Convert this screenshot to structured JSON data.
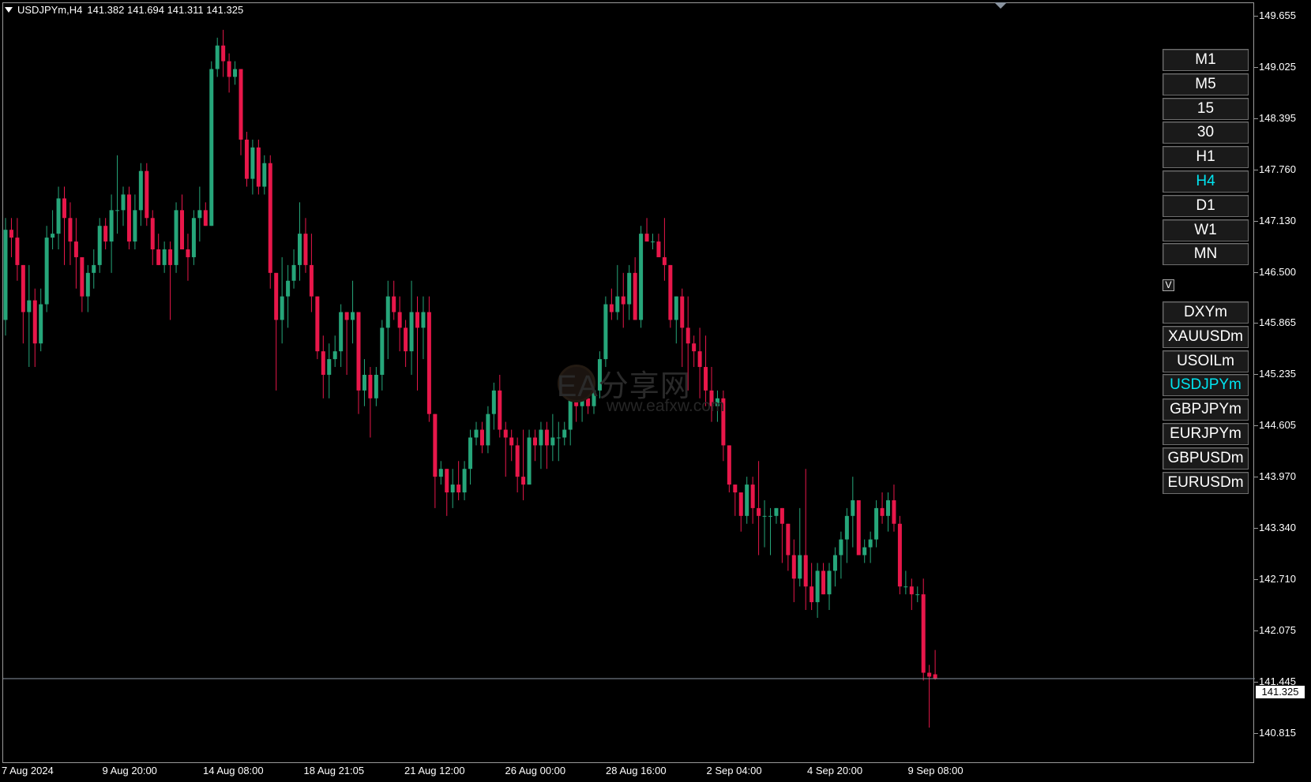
{
  "header": {
    "symbol_timeframe": "USDJPYm,H4",
    "ohlc": "141.382 141.694 141.311 141.325"
  },
  "timeframe_buttons": [
    "M1",
    "M5",
    "15",
    "30",
    "H1",
    "H4",
    "D1",
    "W1",
    "MN"
  ],
  "active_timeframe": "H4",
  "toggle_label": "V",
  "symbol_buttons": [
    "DXYm",
    "XAUUSDm",
    "USOILm",
    "USDJPYm",
    "GBPJPYm",
    "EURJPYm",
    "GBPUSDm",
    "EURUSDm"
  ],
  "active_symbol": "USDJPYm",
  "price_axis": [
    "149.655",
    "149.025",
    "148.395",
    "147.760",
    "147.130",
    "146.500",
    "145.865",
    "145.235",
    "144.605",
    "143.970",
    "143.340",
    "142.710",
    "142.075",
    "141.445",
    "140.815"
  ],
  "time_axis": [
    "7 Aug 2024",
    "9 Aug 20:00",
    "14 Aug 08:00",
    "18 Aug 21:05",
    "21 Aug 12:00",
    "26 Aug 00:00",
    "28 Aug 16:00",
    "2 Sep 04:00",
    "4 Sep 20:00",
    "9 Sep 08:00"
  ],
  "bid_price": "141.325",
  "watermark": {
    "title": "EA分享网",
    "url": "www.eafxw.com"
  },
  "colors": {
    "bull": "#26a67a",
    "bear": "#e8174a",
    "active_text": "#00e4f0",
    "bid_line": "#8a94a0"
  },
  "chart_data": {
    "type": "candlestick",
    "ylim": [
      140.6,
      149.85
    ],
    "bid": 141.325,
    "candles": [
      [
        145.9,
        147.2,
        145.7,
        147.05
      ],
      [
        147.05,
        147.2,
        146.7,
        146.95
      ],
      [
        146.95,
        147.2,
        146.4,
        146.6
      ],
      [
        146.6,
        146.6,
        145.6,
        146.0
      ],
      [
        146.0,
        146.6,
        145.3,
        146.15
      ],
      [
        146.15,
        146.3,
        145.3,
        145.6
      ],
      [
        145.6,
        146.3,
        145.5,
        146.1
      ],
      [
        146.1,
        147.1,
        146.0,
        146.95
      ],
      [
        146.95,
        147.3,
        146.8,
        147.0
      ],
      [
        147.0,
        147.6,
        146.8,
        147.45
      ],
      [
        147.45,
        147.6,
        146.6,
        147.2
      ],
      [
        147.2,
        147.4,
        146.6,
        146.9
      ],
      [
        146.9,
        147.2,
        146.3,
        146.7
      ],
      [
        146.7,
        146.7,
        146.0,
        146.2
      ],
      [
        146.2,
        146.6,
        146.0,
        146.5
      ],
      [
        146.5,
        146.8,
        146.3,
        146.6
      ],
      [
        146.6,
        147.2,
        146.5,
        147.1
      ],
      [
        147.1,
        147.2,
        146.8,
        146.9
      ],
      [
        146.9,
        147.5,
        146.5,
        147.3
      ],
      [
        147.3,
        148.0,
        147.0,
        147.3
      ],
      [
        147.3,
        147.6,
        147.1,
        147.5
      ],
      [
        147.5,
        147.6,
        146.8,
        146.9
      ],
      [
        146.9,
        147.5,
        146.8,
        147.3
      ],
      [
        147.3,
        147.9,
        147.1,
        147.8
      ],
      [
        147.8,
        147.9,
        147.1,
        147.2
      ],
      [
        147.2,
        147.3,
        146.6,
        146.8
      ],
      [
        146.8,
        147.0,
        146.6,
        146.6
      ],
      [
        146.6,
        146.9,
        146.5,
        146.8
      ],
      [
        146.8,
        146.9,
        145.9,
        146.6
      ],
      [
        146.6,
        147.4,
        146.5,
        147.3
      ],
      [
        147.3,
        147.5,
        146.8,
        146.8
      ],
      [
        146.8,
        147.0,
        146.4,
        146.7
      ],
      [
        146.7,
        147.3,
        146.6,
        147.2
      ],
      [
        147.2,
        147.6,
        146.9,
        147.3
      ],
      [
        147.3,
        147.4,
        147.1,
        147.1
      ],
      [
        147.1,
        149.2,
        147.1,
        149.1
      ],
      [
        149.1,
        149.5,
        149.0,
        149.4
      ],
      [
        149.4,
        149.6,
        149.0,
        149.2
      ],
      [
        149.2,
        149.3,
        148.8,
        149.0
      ],
      [
        149.0,
        149.2,
        148.9,
        149.1
      ],
      [
        149.1,
        149.1,
        148.0,
        148.2
      ],
      [
        148.2,
        148.3,
        147.6,
        147.7
      ],
      [
        147.7,
        148.2,
        147.5,
        148.1
      ],
      [
        148.1,
        148.2,
        147.5,
        147.6
      ],
      [
        147.6,
        148.0,
        147.5,
        147.9
      ],
      [
        147.9,
        148.0,
        146.3,
        146.5
      ],
      [
        146.5,
        146.5,
        145.0,
        145.9
      ],
      [
        145.9,
        146.7,
        145.6,
        146.2
      ],
      [
        146.2,
        146.6,
        145.8,
        146.4
      ],
      [
        146.4,
        146.8,
        146.3,
        146.6
      ],
      [
        146.6,
        147.4,
        146.4,
        147.0
      ],
      [
        147.0,
        147.2,
        146.5,
        146.6
      ],
      [
        146.6,
        147.0,
        146.0,
        146.2
      ],
      [
        146.2,
        146.2,
        145.4,
        145.5
      ],
      [
        145.5,
        145.7,
        144.9,
        145.2
      ],
      [
        145.2,
        145.6,
        144.9,
        145.4
      ],
      [
        145.4,
        145.7,
        145.3,
        145.5
      ],
      [
        145.5,
        146.1,
        145.3,
        146.0
      ],
      [
        146.0,
        146.0,
        145.2,
        145.9
      ],
      [
        145.9,
        146.4,
        145.6,
        146.0
      ],
      [
        146.0,
        146.0,
        144.7,
        145.0
      ],
      [
        145.0,
        145.4,
        144.8,
        145.2
      ],
      [
        145.2,
        145.3,
        144.4,
        144.9
      ],
      [
        144.9,
        145.3,
        144.8,
        145.2
      ],
      [
        145.2,
        145.9,
        145.0,
        145.8
      ],
      [
        145.8,
        146.4,
        145.4,
        146.2
      ],
      [
        146.2,
        146.4,
        145.9,
        146.0
      ],
      [
        146.0,
        146.2,
        145.5,
        145.8
      ],
      [
        145.8,
        145.9,
        145.3,
        145.5
      ],
      [
        145.5,
        146.4,
        145.2,
        146.0
      ],
      [
        146.0,
        146.2,
        145.0,
        145.8
      ],
      [
        145.8,
        146.2,
        145.4,
        146.0
      ],
      [
        146.0,
        146.2,
        144.6,
        144.7
      ],
      [
        144.7,
        144.7,
        143.5,
        143.9
      ],
      [
        143.9,
        144.1,
        143.8,
        144.0
      ],
      [
        144.0,
        144.0,
        143.4,
        143.7
      ],
      [
        143.7,
        144.0,
        143.5,
        143.8
      ],
      [
        143.8,
        144.1,
        143.6,
        143.7
      ],
      [
        143.7,
        144.1,
        143.6,
        144.0
      ],
      [
        144.0,
        144.5,
        143.8,
        144.4
      ],
      [
        144.4,
        144.6,
        144.3,
        144.5
      ],
      [
        144.5,
        144.6,
        144.2,
        144.3
      ],
      [
        144.3,
        144.8,
        144.2,
        144.7
      ],
      [
        144.7,
        145.1,
        144.5,
        145.0
      ],
      [
        145.0,
        145.2,
        144.4,
        144.5
      ],
      [
        144.5,
        144.6,
        143.9,
        144.4
      ],
      [
        144.4,
        144.5,
        144.1,
        144.3
      ],
      [
        144.3,
        144.4,
        143.7,
        143.9
      ],
      [
        143.9,
        144.5,
        143.6,
        143.8
      ],
      [
        143.8,
        144.5,
        143.8,
        144.4
      ],
      [
        144.4,
        144.5,
        144.1,
        144.3
      ],
      [
        144.3,
        144.6,
        144.0,
        144.5
      ],
      [
        144.5,
        144.6,
        144.0,
        144.3
      ],
      [
        144.3,
        144.7,
        144.1,
        144.4
      ],
      [
        144.4,
        144.6,
        144.1,
        144.4
      ],
      [
        144.4,
        144.6,
        144.3,
        144.5
      ],
      [
        144.5,
        145.0,
        144.3,
        144.9
      ],
      [
        144.9,
        145.1,
        144.6,
        144.8
      ],
      [
        144.8,
        145.2,
        144.6,
        144.9
      ],
      [
        144.9,
        145.0,
        144.7,
        144.8
      ],
      [
        144.8,
        145.1,
        144.7,
        145.0
      ],
      [
        145.0,
        145.5,
        144.9,
        145.4
      ],
      [
        145.4,
        146.2,
        145.3,
        146.1
      ],
      [
        146.1,
        146.3,
        145.9,
        146.0
      ],
      [
        146.0,
        146.6,
        145.9,
        146.2
      ],
      [
        146.2,
        146.5,
        145.8,
        146.1
      ],
      [
        146.1,
        146.6,
        145.9,
        146.5
      ],
      [
        146.5,
        146.7,
        145.9,
        145.9
      ],
      [
        145.9,
        147.1,
        145.8,
        147.0
      ],
      [
        147.0,
        147.2,
        146.9,
        146.9
      ],
      [
        146.9,
        147.0,
        146.8,
        146.9
      ],
      [
        146.9,
        147.0,
        146.7,
        146.7
      ],
      [
        146.7,
        147.2,
        146.4,
        146.6
      ],
      [
        146.6,
        146.6,
        145.8,
        145.9
      ],
      [
        145.9,
        146.2,
        145.6,
        146.2
      ],
      [
        146.2,
        146.3,
        145.3,
        145.8
      ],
      [
        145.8,
        146.2,
        145.0,
        145.6
      ],
      [
        145.6,
        145.7,
        145.3,
        145.5
      ],
      [
        145.5,
        145.8,
        144.9,
        145.3
      ],
      [
        145.3,
        145.7,
        144.8,
        145.0
      ],
      [
        145.0,
        145.3,
        144.6,
        144.8
      ],
      [
        144.8,
        145.0,
        144.6,
        144.9
      ],
      [
        144.9,
        145.0,
        144.1,
        144.3
      ],
      [
        144.3,
        144.3,
        143.7,
        143.8
      ],
      [
        143.8,
        143.8,
        143.4,
        143.7
      ],
      [
        143.7,
        143.7,
        143.2,
        143.4
      ],
      [
        143.4,
        143.9,
        143.3,
        143.8
      ],
      [
        143.8,
        143.9,
        143.3,
        143.5
      ],
      [
        143.5,
        144.1,
        142.9,
        143.4
      ],
      [
        143.4,
        143.6,
        143.0,
        143.4
      ],
      [
        143.4,
        143.5,
        142.9,
        143.4
      ],
      [
        143.4,
        143.5,
        143.3,
        143.5
      ],
      [
        143.5,
        143.5,
        142.8,
        143.3
      ],
      [
        143.3,
        143.3,
        142.7,
        142.9
      ],
      [
        142.9,
        143.1,
        142.3,
        142.6
      ],
      [
        142.6,
        143.5,
        142.5,
        142.9
      ],
      [
        142.9,
        144.0,
        142.2,
        142.5
      ],
      [
        142.5,
        142.8,
        142.2,
        142.3
      ],
      [
        142.3,
        142.8,
        142.1,
        142.7
      ],
      [
        142.7,
        142.8,
        142.4,
        142.4
      ],
      [
        142.4,
        142.8,
        142.2,
        142.7
      ],
      [
        142.7,
        143.0,
        142.5,
        142.9
      ],
      [
        142.9,
        143.2,
        142.6,
        143.1
      ],
      [
        143.1,
        143.5,
        142.8,
        143.4
      ],
      [
        143.4,
        143.9,
        143.0,
        143.6
      ],
      [
        143.6,
        143.6,
        142.9,
        142.9
      ],
      [
        142.9,
        143.1,
        142.8,
        143.0
      ],
      [
        143.0,
        143.2,
        142.8,
        143.1
      ],
      [
        143.1,
        143.6,
        143.0,
        143.5
      ],
      [
        143.5,
        143.7,
        143.3,
        143.4
      ],
      [
        143.4,
        143.7,
        143.2,
        143.6
      ],
      [
        143.6,
        143.8,
        143.2,
        143.3
      ],
      [
        143.3,
        143.4,
        142.4,
        142.5
      ],
      [
        142.5,
        142.7,
        142.4,
        142.5
      ],
      [
        142.5,
        142.6,
        142.2,
        142.4
      ],
      [
        142.4,
        142.5,
        142.3,
        142.4
      ],
      [
        142.4,
        142.6,
        141.3,
        141.4
      ],
      [
        141.4,
        141.5,
        140.7,
        141.35
      ],
      [
        141.38,
        141.69,
        141.31,
        141.33
      ]
    ]
  }
}
